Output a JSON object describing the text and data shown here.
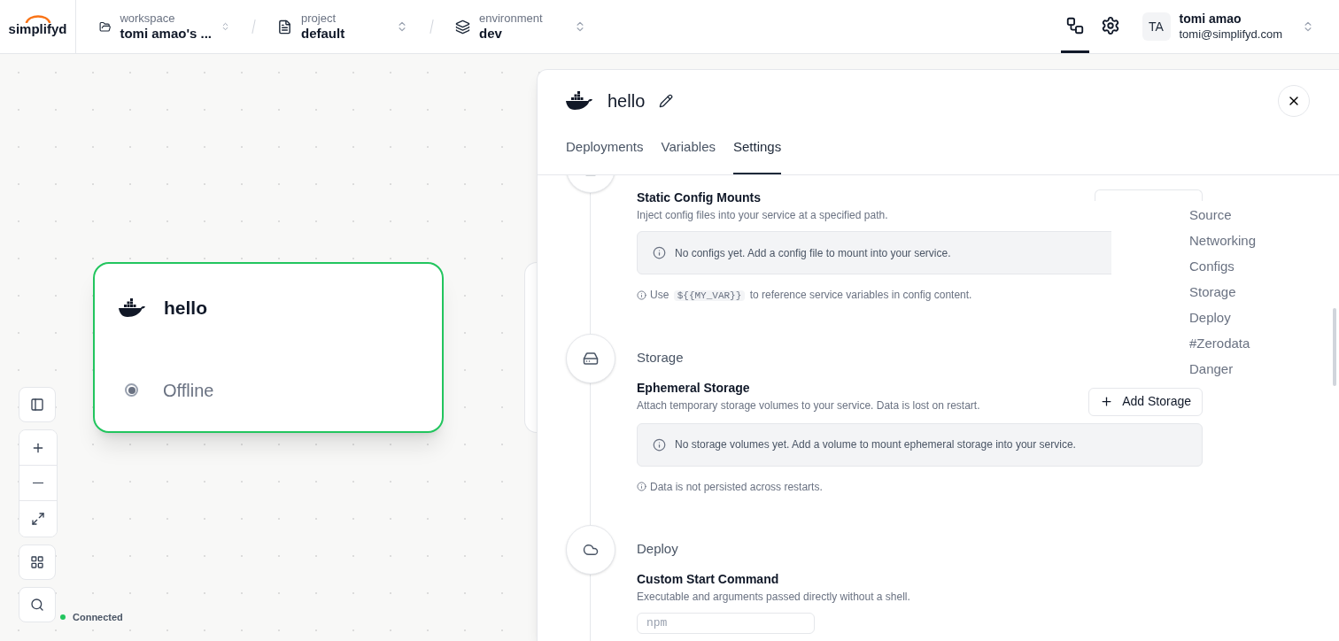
{
  "header": {
    "logo": "simplifyd",
    "selectors": [
      {
        "kind": "folder",
        "label": "workspace",
        "value": "tomi amao's ..."
      },
      {
        "kind": "document",
        "label": "project",
        "value": "default"
      },
      {
        "kind": "layers",
        "label": "environment",
        "value": "dev"
      }
    ],
    "nav_icons": [
      {
        "kind": "graph",
        "selected": true
      },
      {
        "kind": "settings",
        "selected": false
      }
    ],
    "user": {
      "initials": "TA",
      "name": "tomi amao",
      "email": "tomi@simplifyd.com"
    }
  },
  "canvas": {
    "node": {
      "title": "hello",
      "status": "Offline"
    },
    "connection": {
      "label": "Connected",
      "color": "#22c55e"
    }
  },
  "panel": {
    "title": "hello",
    "tabs": [
      {
        "label": "Deployments",
        "selected": false
      },
      {
        "label": "Variables",
        "selected": false
      },
      {
        "label": "Settings",
        "selected": true
      }
    ],
    "sections": [
      {
        "kind": "configs",
        "blocks": [
          {
            "kind": "list",
            "title": "Static Config Mounts",
            "description": "Inject config files into your service at a specified path.",
            "empty_text": "No configs yet. Add a config file to mount into your service.",
            "note": [
              "Use ",
              "${{MY_VAR}}",
              " to reference service variables in config content."
            ]
          }
        ]
      },
      {
        "kind": "storage",
        "title": "Storage",
        "blocks": [
          {
            "kind": "list",
            "title": "Ephemeral Storage",
            "description": "Attach temporary storage volumes to your service. Data is lost on restart.",
            "button": "Add Storage",
            "empty_text": "No storage volumes yet. Add a volume to mount ephemeral storage into your service.",
            "note": [
              "Data is not persisted across restarts."
            ]
          }
        ]
      },
      {
        "kind": "deploy",
        "title": "Deploy",
        "blocks": [
          {
            "kind": "input",
            "title": "Custom Start Command",
            "description": "Executable and arguments passed directly without a shell.",
            "placeholder": "npm"
          }
        ]
      }
    ],
    "section_nav": [
      "Source",
      "Networking",
      "Configs",
      "Storage",
      "Deploy",
      "#Zerodata",
      "Danger"
    ]
  }
}
